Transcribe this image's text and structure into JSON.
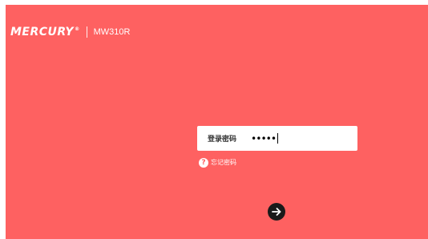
{
  "brand": {
    "logo_text": "MERCURY",
    "registered_mark": "®",
    "model": "MW310R"
  },
  "login": {
    "password_label": "登录密码",
    "password_value": "•••••",
    "forgot_password": "忘记密码",
    "help_icon_glyph": "?",
    "submit_icon": "arrow-right-icon"
  },
  "colors": {
    "background": "#fe6161",
    "field_background": "#ffffff",
    "submit_button": "#1a1a1a"
  }
}
